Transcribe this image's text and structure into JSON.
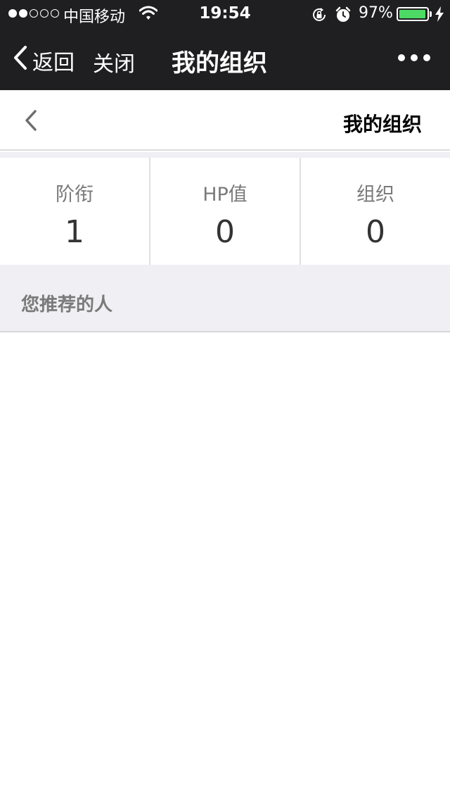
{
  "status_bar": {
    "carrier": "中国移动",
    "time": "19:54",
    "battery": "97%",
    "battery_level": 0.97,
    "icons": [
      "signal-dots-icon",
      "wifi-icon",
      "rotation-lock-icon",
      "alarm-icon",
      "battery-icon",
      "charging-icon"
    ]
  },
  "nav": {
    "back_label": "返回",
    "close_label": "关闭",
    "title": "我的组织",
    "more_icon": "more-dots-icon"
  },
  "page": {
    "title": "我的组织",
    "back_icon": "chevron-left-icon"
  },
  "stats": [
    {
      "label": "阶衔",
      "value": "1"
    },
    {
      "label": "HP值",
      "value": "0"
    },
    {
      "label": "组织",
      "value": "0"
    }
  ],
  "section": {
    "label": "您推荐的人"
  },
  "colors": {
    "nav_background": "#1f1f21",
    "page_background": "#ffffff",
    "section_background": "#efeff4",
    "battery_fill": "#4cd964"
  }
}
